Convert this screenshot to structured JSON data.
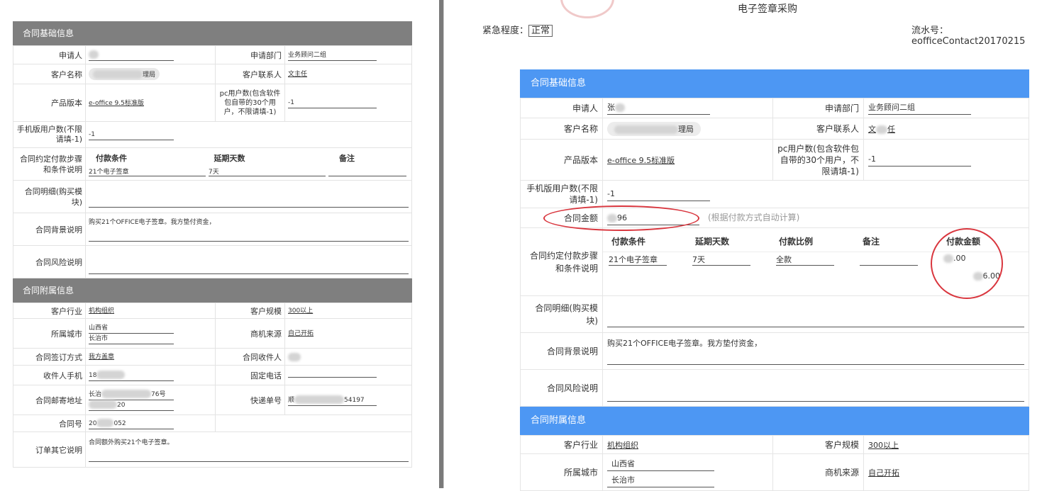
{
  "left": {
    "basic_title": "合同基础信息",
    "applicant_label": "申请人",
    "dept_label": "申请部门",
    "dept_value": "业务顾问二组",
    "customer_label": "客户名称",
    "customer_suffix": "理局",
    "contact_label": "客户联系人",
    "contact_value": "文主任",
    "version_label": "产品版本",
    "version_value": "e-office 9.5标准版",
    "pc_users_label": "pc用户数(包含软件包自带的30个用户，不限请填-1)",
    "pc_users_value": "-1",
    "mobile_users_label": "手机版用户数(不限请填-1)",
    "mobile_users_value": "-1",
    "pay_steps_label": "合同约定付款步骤和条件说明",
    "pay_headers": [
      "付款条件",
      "延期天数",
      "备注"
    ],
    "pay_row": [
      "21个电子签章",
      "7天",
      ""
    ],
    "detail_label": "合同明细(购买模块)",
    "background_label": "合同背景说明",
    "background_value": "购买21个OFFICE电子签章。我方垫付资金，",
    "risk_label": "合同风险说明",
    "attach_title": "合同附属信息",
    "industry_label": "客户行业",
    "industry_value": "机构组织",
    "scale_label": "客户规模",
    "scale_value": "300以上",
    "city_label": "所属城市",
    "city_value1": "山西省",
    "city_value2": "长治市",
    "source_label": "商机来源",
    "source_value": "自己开拓",
    "sign_label": "合同签订方式",
    "sign_value": "我方盖章",
    "receiver_label": "合同收件人",
    "phone_label": "收件人手机",
    "phone_value": "18",
    "tel_label": "固定电话",
    "address_label": "合同邮寄地址",
    "address_value1": "长治",
    "address_value1_suffix": "76号",
    "address_value2": "20",
    "express_label": "快递单号",
    "express_value": "顺",
    "express_suffix": "54197",
    "contract_no_label": "合同号",
    "contract_no_value": "20",
    "contract_no_suffix": "052",
    "other_label": "订单其它说明",
    "other_value": "合同额外购买21个电子签章。"
  },
  "right": {
    "doc_title": "电子签章采购",
    "urgency_label": "紧急程度：",
    "urgency_value": "正常",
    "serial_label": "流水号：",
    "serial_value": "eofficeContact20170215",
    "basic_title": "合同基础信息",
    "applicant_label": "申请人",
    "applicant_value": "张",
    "dept_label": "申请部门",
    "dept_value": "业务顾问二组",
    "customer_label": "客户名称",
    "customer_suffix": "理局",
    "contact_label": "客户联系人",
    "contact_value": "文",
    "contact_suffix": "任",
    "version_label": "产品版本",
    "version_value": "e-office 9.5标准版",
    "pc_users_label": "pc用户数(包含软件包自带的30个用户，不限请填-1)",
    "pc_users_value": "-1",
    "mobile_users_label": "手机版用户数(不限请填-1)",
    "mobile_users_value": "-1",
    "amount_label": "合同金额",
    "amount_value": "96",
    "amount_hint": "(根据付款方式自动计算)",
    "pay_steps_label": "合同约定付款步骤和条件说明",
    "pay_headers": [
      "付款条件",
      "延期天数",
      "付款比例",
      "备注",
      "付款金额"
    ],
    "pay_row": [
      "21个电子签章",
      "7天",
      "全款",
      "",
      ".00"
    ],
    "pay_total": "6.00",
    "detail_label": "合同明细(购买模块)",
    "background_label": "合同背景说明",
    "background_value": "购买21个OFFICE电子签章。我方垫付资金，",
    "risk_label": "合同风险说明",
    "attach_title": "合同附属信息",
    "industry_label": "客户行业",
    "industry_value": "机构组织",
    "scale_label": "客户规模",
    "scale_value": "300以上",
    "city_label": "所属城市",
    "city_value1": "山西省",
    "city_value2": "长治市",
    "source_label": "商机来源",
    "source_value": "自己开拓"
  },
  "colors": {
    "left_header": "#7f7f7f",
    "right_header": "#4d97f3",
    "annotation": "#d9363e"
  }
}
